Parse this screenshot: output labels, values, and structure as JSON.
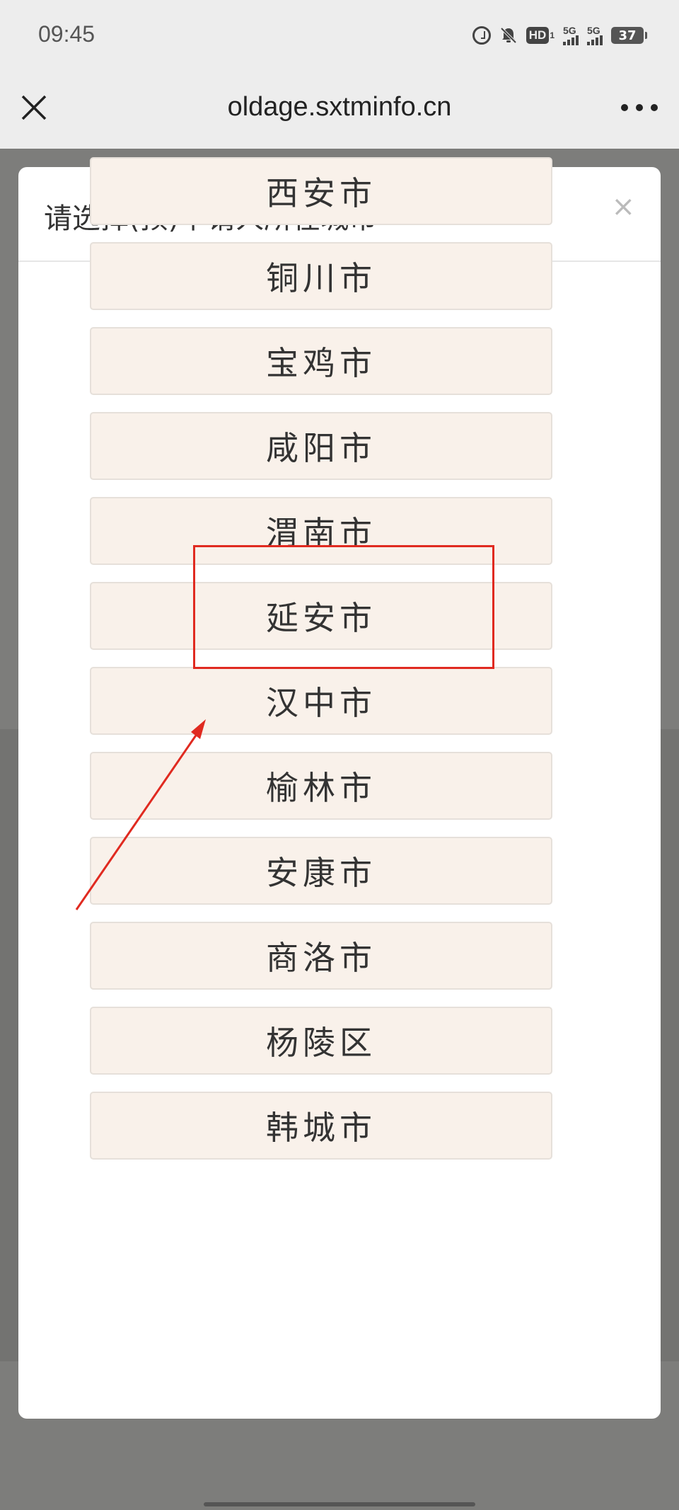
{
  "status_bar": {
    "time": "09:45",
    "icons": [
      "alarm-icon",
      "bell-off-icon",
      "hd-icon",
      "signal-5g-icon",
      "signal-5g-icon",
      "battery-icon"
    ],
    "hd_label": "HD",
    "hd_sup": "1",
    "net1": "5G",
    "net2": "5G",
    "battery_level": "37"
  },
  "browser": {
    "url": "oldage.sxtminfo.cn",
    "close_icon": "close-icon",
    "menu_icon": "more-icon"
  },
  "modal": {
    "title": "请选择(预)申请人所在城市",
    "close_label": "×",
    "cities": [
      "西安市",
      "铜川市",
      "宝鸡市",
      "咸阳市",
      "渭南市",
      "延安市",
      "汉中市",
      "榆林市",
      "安康市",
      "商洛市",
      "杨陵区",
      "韩城市"
    ]
  },
  "colors": {
    "option_bg": "#f9f1ea",
    "annotation": "#e02a20",
    "overlay": "#7d7d7b"
  }
}
